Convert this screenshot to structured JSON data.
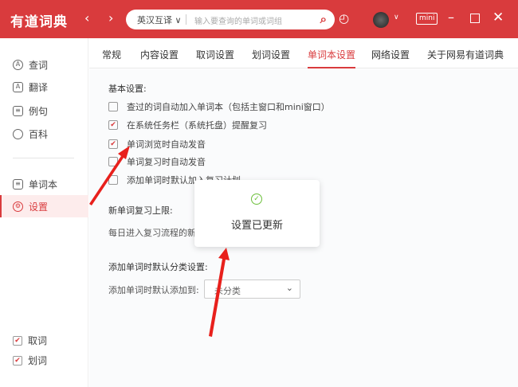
{
  "header": {
    "logo": "有道词典",
    "back": "‹",
    "forward": "›",
    "search_lang": "英汉互译 ∨",
    "search_placeholder": "输入要查询的单词或词组",
    "mini": "mini"
  },
  "tabs": [
    "常规",
    "内容设置",
    "取词设置",
    "划词设置",
    "单词本设置",
    "网络设置",
    "关于网易有道词典"
  ],
  "sidebar": {
    "items": [
      "查词",
      "翻译",
      "例句",
      "百科"
    ],
    "items2": [
      "单词本",
      "设置"
    ],
    "bottom": [
      "取词",
      "划词"
    ]
  },
  "settings": {
    "basic_title": "基本设置:",
    "options": [
      {
        "label": "查过的词自动加入单词本（包括主窗口和mini窗口）",
        "checked": false
      },
      {
        "label": "在系统任务栏（系统托盘）提醒复习",
        "checked": true
      },
      {
        "label": "单词浏览时自动发音",
        "checked": true
      },
      {
        "label": "单词复习时自动发音",
        "checked": false
      },
      {
        "label": "添加单词时默认加入复习计划",
        "checked": false
      }
    ],
    "limit_title": "新单词复习上限:",
    "limit_text": "每日进入复习流程的新单词数",
    "category_title": "添加单词时默认分类设置:",
    "category_label": "添加单词时默认添加到:",
    "category_value": "未分类"
  },
  "toast": {
    "message": "设置已更新"
  },
  "colors": {
    "brand": "#d93b3d",
    "success": "#6bbf3a"
  }
}
